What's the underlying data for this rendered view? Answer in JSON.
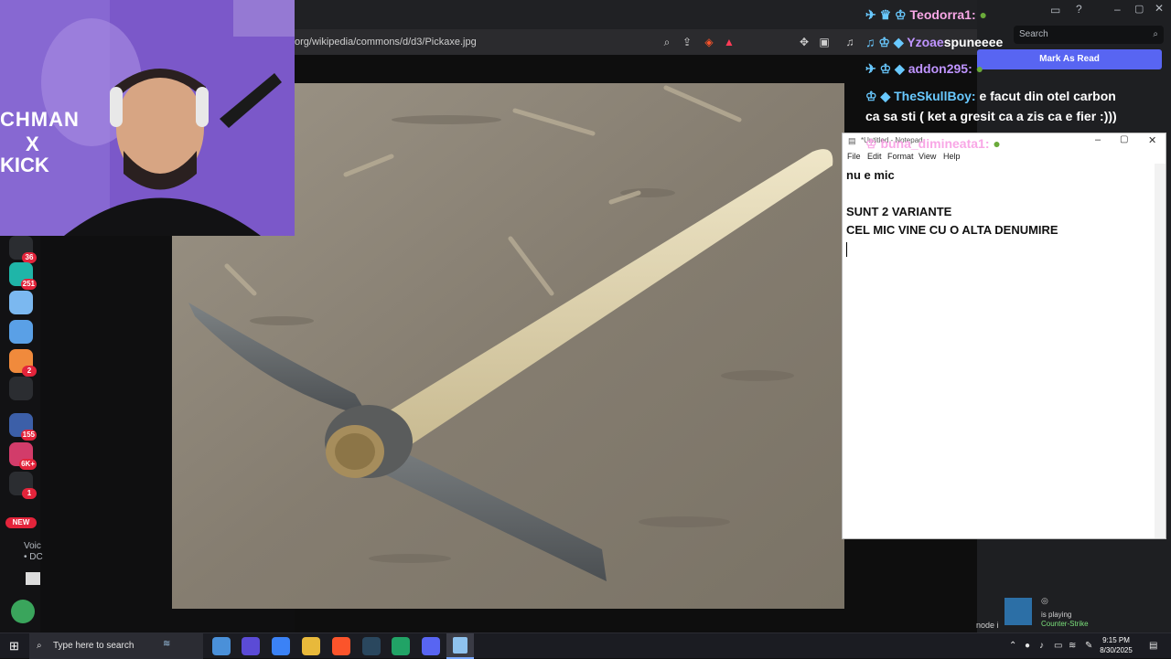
{
  "browser": {
    "url": "org/wikipedia/commons/d/d3/Pickaxe.jpg"
  },
  "webcam": {
    "poster_text_line1": "CHMAN",
    "poster_text_line2": "X",
    "poster_text_line3": "KICK"
  },
  "chat": {
    "lines": [
      {
        "user": "Teodorra1:",
        "message": ""
      },
      {
        "user": "Yzoae",
        "message": "spuneeee"
      },
      {
        "user": "addon295:",
        "message": ""
      },
      {
        "user": "TheSkullBoy:",
        "message": "e facut din otel carbon"
      },
      {
        "user": "",
        "message": "ca sa sti ( ket a gresit ca a zis ca e fier :)))"
      },
      {
        "user": "buna_dimineata1:",
        "message": ""
      }
    ]
  },
  "discord": {
    "search_placeholder": "Search",
    "mark_as_read": "Mark As Read",
    "left_badges": [
      "36",
      "251",
      "2",
      "155",
      "6K+",
      "1"
    ],
    "new_badge": "NEW",
    "voice_label_1": "Voic",
    "voice_label_2": "• DC",
    "game_status": "is playing",
    "game_name": "Counter-Strike",
    "mode_hint": "node i"
  },
  "notepad": {
    "title": "*Untitled - Notepad",
    "menu": [
      "File",
      "Edit",
      "Format",
      "View",
      "Help"
    ],
    "lines": [
      "nu e mic",
      "",
      "SUNT 2 VARIANTE",
      "CEL MIC VINE CU O ALTA DENUMIRE",
      ""
    ]
  },
  "taskbar": {
    "search_placeholder": "Type here to search",
    "time": "9:15 PM",
    "date": "8/30/2025"
  },
  "colors": {
    "accent": "#5865f2",
    "badge": "#e3243b",
    "taskbar": "#1b1c22"
  }
}
